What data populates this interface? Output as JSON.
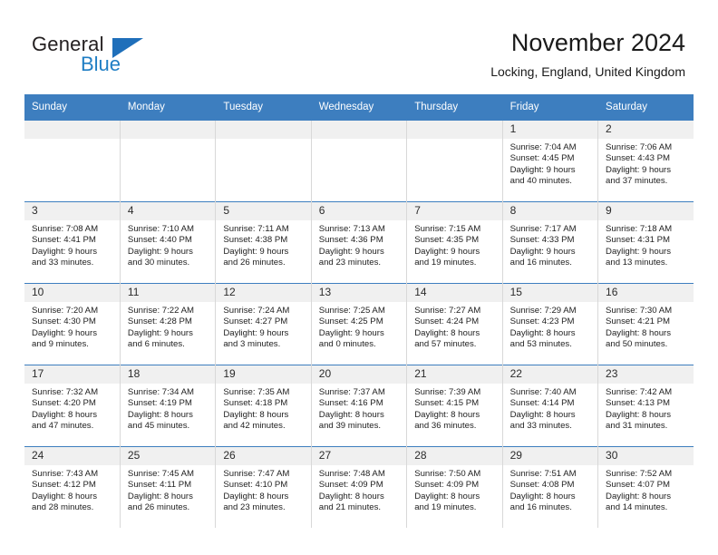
{
  "brand": {
    "name_top": "General",
    "name_bottom": "Blue",
    "triangle_color": "#1f6fba",
    "blue_text_color": "#1f7ec4"
  },
  "header": {
    "title": "November 2024",
    "location": "Locking, England, United Kingdom"
  },
  "theme": {
    "header_bg": "#3d7ebf",
    "header_text": "#ffffff",
    "daynum_strip_bg": "#f0f0f0",
    "cell_bg": "#ffffff",
    "cell_border": "#d8d8d8",
    "row_border": "#3d7ebf"
  },
  "weekday_headers": [
    "Sunday",
    "Monday",
    "Tuesday",
    "Wednesday",
    "Thursday",
    "Friday",
    "Saturday"
  ],
  "weeks": [
    [
      {
        "day": "",
        "blank": true
      },
      {
        "day": "",
        "blank": true
      },
      {
        "day": "",
        "blank": true
      },
      {
        "day": "",
        "blank": true
      },
      {
        "day": "",
        "blank": true
      },
      {
        "day": "1",
        "sunrise": "Sunrise: 7:04 AM",
        "sunset": "Sunset: 4:45 PM",
        "daylight_line1": "Daylight: 9 hours",
        "daylight_line2": "and 40 minutes."
      },
      {
        "day": "2",
        "sunrise": "Sunrise: 7:06 AM",
        "sunset": "Sunset: 4:43 PM",
        "daylight_line1": "Daylight: 9 hours",
        "daylight_line2": "and 37 minutes."
      }
    ],
    [
      {
        "day": "3",
        "sunrise": "Sunrise: 7:08 AM",
        "sunset": "Sunset: 4:41 PM",
        "daylight_line1": "Daylight: 9 hours",
        "daylight_line2": "and 33 minutes."
      },
      {
        "day": "4",
        "sunrise": "Sunrise: 7:10 AM",
        "sunset": "Sunset: 4:40 PM",
        "daylight_line1": "Daylight: 9 hours",
        "daylight_line2": "and 30 minutes."
      },
      {
        "day": "5",
        "sunrise": "Sunrise: 7:11 AM",
        "sunset": "Sunset: 4:38 PM",
        "daylight_line1": "Daylight: 9 hours",
        "daylight_line2": "and 26 minutes."
      },
      {
        "day": "6",
        "sunrise": "Sunrise: 7:13 AM",
        "sunset": "Sunset: 4:36 PM",
        "daylight_line1": "Daylight: 9 hours",
        "daylight_line2": "and 23 minutes."
      },
      {
        "day": "7",
        "sunrise": "Sunrise: 7:15 AM",
        "sunset": "Sunset: 4:35 PM",
        "daylight_line1": "Daylight: 9 hours",
        "daylight_line2": "and 19 minutes."
      },
      {
        "day": "8",
        "sunrise": "Sunrise: 7:17 AM",
        "sunset": "Sunset: 4:33 PM",
        "daylight_line1": "Daylight: 9 hours",
        "daylight_line2": "and 16 minutes."
      },
      {
        "day": "9",
        "sunrise": "Sunrise: 7:18 AM",
        "sunset": "Sunset: 4:31 PM",
        "daylight_line1": "Daylight: 9 hours",
        "daylight_line2": "and 13 minutes."
      }
    ],
    [
      {
        "day": "10",
        "sunrise": "Sunrise: 7:20 AM",
        "sunset": "Sunset: 4:30 PM",
        "daylight_line1": "Daylight: 9 hours",
        "daylight_line2": "and 9 minutes."
      },
      {
        "day": "11",
        "sunrise": "Sunrise: 7:22 AM",
        "sunset": "Sunset: 4:28 PM",
        "daylight_line1": "Daylight: 9 hours",
        "daylight_line2": "and 6 minutes."
      },
      {
        "day": "12",
        "sunrise": "Sunrise: 7:24 AM",
        "sunset": "Sunset: 4:27 PM",
        "daylight_line1": "Daylight: 9 hours",
        "daylight_line2": "and 3 minutes."
      },
      {
        "day": "13",
        "sunrise": "Sunrise: 7:25 AM",
        "sunset": "Sunset: 4:25 PM",
        "daylight_line1": "Daylight: 9 hours",
        "daylight_line2": "and 0 minutes."
      },
      {
        "day": "14",
        "sunrise": "Sunrise: 7:27 AM",
        "sunset": "Sunset: 4:24 PM",
        "daylight_line1": "Daylight: 8 hours",
        "daylight_line2": "and 57 minutes."
      },
      {
        "day": "15",
        "sunrise": "Sunrise: 7:29 AM",
        "sunset": "Sunset: 4:23 PM",
        "daylight_line1": "Daylight: 8 hours",
        "daylight_line2": "and 53 minutes."
      },
      {
        "day": "16",
        "sunrise": "Sunrise: 7:30 AM",
        "sunset": "Sunset: 4:21 PM",
        "daylight_line1": "Daylight: 8 hours",
        "daylight_line2": "and 50 minutes."
      }
    ],
    [
      {
        "day": "17",
        "sunrise": "Sunrise: 7:32 AM",
        "sunset": "Sunset: 4:20 PM",
        "daylight_line1": "Daylight: 8 hours",
        "daylight_line2": "and 47 minutes."
      },
      {
        "day": "18",
        "sunrise": "Sunrise: 7:34 AM",
        "sunset": "Sunset: 4:19 PM",
        "daylight_line1": "Daylight: 8 hours",
        "daylight_line2": "and 45 minutes."
      },
      {
        "day": "19",
        "sunrise": "Sunrise: 7:35 AM",
        "sunset": "Sunset: 4:18 PM",
        "daylight_line1": "Daylight: 8 hours",
        "daylight_line2": "and 42 minutes."
      },
      {
        "day": "20",
        "sunrise": "Sunrise: 7:37 AM",
        "sunset": "Sunset: 4:16 PM",
        "daylight_line1": "Daylight: 8 hours",
        "daylight_line2": "and 39 minutes."
      },
      {
        "day": "21",
        "sunrise": "Sunrise: 7:39 AM",
        "sunset": "Sunset: 4:15 PM",
        "daylight_line1": "Daylight: 8 hours",
        "daylight_line2": "and 36 minutes."
      },
      {
        "day": "22",
        "sunrise": "Sunrise: 7:40 AM",
        "sunset": "Sunset: 4:14 PM",
        "daylight_line1": "Daylight: 8 hours",
        "daylight_line2": "and 33 minutes."
      },
      {
        "day": "23",
        "sunrise": "Sunrise: 7:42 AM",
        "sunset": "Sunset: 4:13 PM",
        "daylight_line1": "Daylight: 8 hours",
        "daylight_line2": "and 31 minutes."
      }
    ],
    [
      {
        "day": "24",
        "sunrise": "Sunrise: 7:43 AM",
        "sunset": "Sunset: 4:12 PM",
        "daylight_line1": "Daylight: 8 hours",
        "daylight_line2": "and 28 minutes."
      },
      {
        "day": "25",
        "sunrise": "Sunrise: 7:45 AM",
        "sunset": "Sunset: 4:11 PM",
        "daylight_line1": "Daylight: 8 hours",
        "daylight_line2": "and 26 minutes."
      },
      {
        "day": "26",
        "sunrise": "Sunrise: 7:47 AM",
        "sunset": "Sunset: 4:10 PM",
        "daylight_line1": "Daylight: 8 hours",
        "daylight_line2": "and 23 minutes."
      },
      {
        "day": "27",
        "sunrise": "Sunrise: 7:48 AM",
        "sunset": "Sunset: 4:09 PM",
        "daylight_line1": "Daylight: 8 hours",
        "daylight_line2": "and 21 minutes."
      },
      {
        "day": "28",
        "sunrise": "Sunrise: 7:50 AM",
        "sunset": "Sunset: 4:09 PM",
        "daylight_line1": "Daylight: 8 hours",
        "daylight_line2": "and 19 minutes."
      },
      {
        "day": "29",
        "sunrise": "Sunrise: 7:51 AM",
        "sunset": "Sunset: 4:08 PM",
        "daylight_line1": "Daylight: 8 hours",
        "daylight_line2": "and 16 minutes."
      },
      {
        "day": "30",
        "sunrise": "Sunrise: 7:52 AM",
        "sunset": "Sunset: 4:07 PM",
        "daylight_line1": "Daylight: 8 hours",
        "daylight_line2": "and 14 minutes."
      }
    ]
  ]
}
